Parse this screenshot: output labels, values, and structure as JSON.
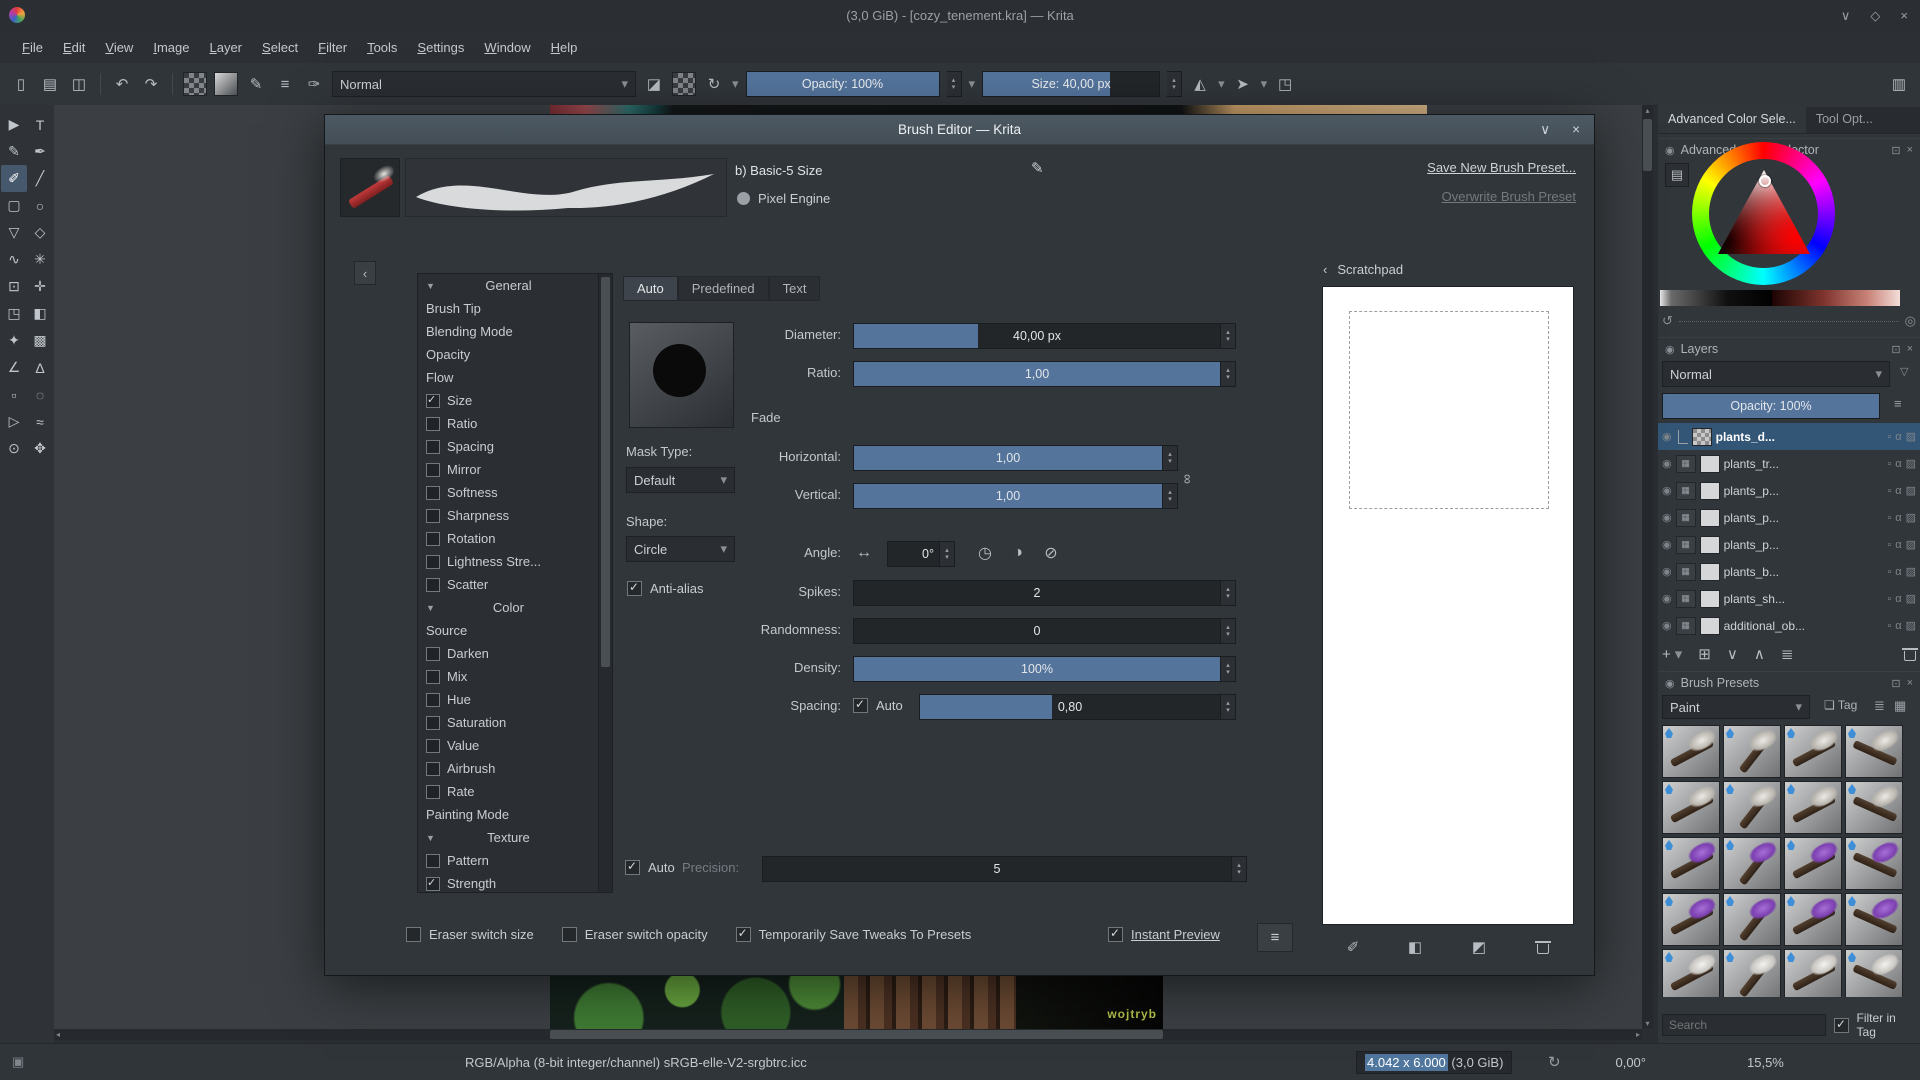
{
  "window": {
    "title": "(3,0 GiB) - [cozy_tenement.kra] — Krita"
  },
  "icons": {
    "shade": "∨",
    "maximize": "◇",
    "close": "×",
    "new_doc": "▯",
    "open": "▤",
    "save": "◫",
    "undo": "↶",
    "redo": "↷",
    "brush_settings": "✎",
    "choices": "≡",
    "brush": "✑",
    "eraser": "◪",
    "reload": "↻",
    "mirror_h": "◭",
    "mirror_v": "➤",
    "trim": "◳",
    "workspace": "▥",
    "collapse": "‹",
    "pencil": "✎",
    "flip": "↔",
    "dial": "◷",
    "half": "◑",
    "slash": "⊘",
    "chain": "∞",
    "burger": "≡",
    "float": "⊡",
    "list_btn": "▤",
    "refresh": "↺",
    "funnel": "▽",
    "eye": "◉",
    "alpha": "α",
    "layer_style": "▨",
    "lock": "▫",
    "plus": "+",
    "duplicate": "⊞",
    "down": "∨",
    "up": "∧",
    "props": "≣",
    "tag": "❏",
    "view_list": "≣",
    "view_grid": "▦",
    "sp_brush": "✐",
    "sp_shade": "◧",
    "sp_fill": "◩",
    "rotation": "↻",
    "selection": "▣",
    "docker_dot": "◉"
  },
  "menu": {
    "items": [
      "File",
      "Edit",
      "View",
      "Image",
      "Layer",
      "Select",
      "Filter",
      "Tools",
      "Settings",
      "Window",
      "Help"
    ]
  },
  "toolbar": {
    "blending_mode": "Normal",
    "opacity_label": "Opacity: 100%",
    "opacity_fill": 100,
    "size_label": "Size: 40,00 px",
    "size_fill": 72
  },
  "toolbox": {
    "tools": [
      {
        "name": "select-shapes-tool",
        "glyph": "▶"
      },
      {
        "name": "text-tool",
        "glyph": "T"
      },
      {
        "name": "edit-shapes-tool",
        "glyph": "✎"
      },
      {
        "name": "calligraphy-tool",
        "glyph": "✒"
      },
      {
        "name": "freehand-brush-tool",
        "glyph": "✐",
        "active": true
      },
      {
        "name": "line-tool",
        "glyph": "╱"
      },
      {
        "name": "rectangle-tool",
        "glyph": "▢"
      },
      {
        "name": "ellipse-tool",
        "glyph": "○"
      },
      {
        "name": "polygon-tool",
        "glyph": "▽"
      },
      {
        "name": "polyline-tool",
        "glyph": "◇"
      },
      {
        "name": "bezier-curve-tool",
        "glyph": "∿"
      },
      {
        "name": "multibrush-tool",
        "glyph": "✳"
      },
      {
        "name": "transform-tool",
        "glyph": "⊡"
      },
      {
        "name": "move-tool",
        "glyph": "✛"
      },
      {
        "name": "crop-tool",
        "glyph": "◳"
      },
      {
        "name": "gradient-tool",
        "glyph": "◧"
      },
      {
        "name": "color-sampler-tool",
        "glyph": "✦"
      },
      {
        "name": "smart-patch-tool",
        "glyph": "▩"
      },
      {
        "name": "assistants-tool",
        "glyph": "∠"
      },
      {
        "name": "measure-tool",
        "glyph": "Δ"
      },
      {
        "name": "rectangular-selection-tool",
        "glyph": "▫"
      },
      {
        "name": "elliptical-selection-tool",
        "glyph": "◌"
      },
      {
        "name": "polygonal-selection-tool",
        "glyph": "▷"
      },
      {
        "name": "freehand-selection-tool",
        "glyph": "≈"
      },
      {
        "name": "zoom-tool",
        "glyph": "⊙"
      },
      {
        "name": "pan-tool",
        "glyph": "✥"
      }
    ]
  },
  "canvas": {
    "watermark": "wojtryb"
  },
  "dialog": {
    "title": "Brush Editor — Krita",
    "preset_name": "b) Basic-5 Size",
    "engine": "Pixel Engine",
    "save_button": "Save New Brush Preset...",
    "overwrite_button": "Overwrite Brush Preset",
    "tabs": [
      {
        "label": "Auto",
        "active": true
      },
      {
        "label": "Predefined"
      },
      {
        "label": "Text"
      }
    ],
    "options": [
      {
        "label": "General",
        "type": "header"
      },
      {
        "label": "Brush Tip",
        "type": "plain"
      },
      {
        "label": "Blending Mode",
        "type": "plain"
      },
      {
        "label": "Opacity",
        "type": "plain"
      },
      {
        "label": "Flow",
        "type": "plain"
      },
      {
        "label": "Size",
        "type": "check",
        "checked": true
      },
      {
        "label": "Ratio",
        "type": "check"
      },
      {
        "label": "Spacing",
        "type": "check"
      },
      {
        "label": "Mirror",
        "type": "check"
      },
      {
        "label": "Softness",
        "type": "check"
      },
      {
        "label": "Sharpness",
        "type": "check"
      },
      {
        "label": "Rotation",
        "type": "check"
      },
      {
        "label": "Lightness Stre...",
        "type": "check"
      },
      {
        "label": "Scatter",
        "type": "check"
      },
      {
        "label": "Color",
        "type": "header"
      },
      {
        "label": "Source",
        "type": "plain"
      },
      {
        "label": "Darken",
        "type": "check"
      },
      {
        "label": "Mix",
        "type": "check"
      },
      {
        "label": "Hue",
        "type": "check"
      },
      {
        "label": "Saturation",
        "type": "check"
      },
      {
        "label": "Value",
        "type": "check"
      },
      {
        "label": "Airbrush",
        "type": "check"
      },
      {
        "label": "Rate",
        "type": "check"
      },
      {
        "label": "Painting Mode",
        "type": "plain"
      },
      {
        "label": "Texture",
        "type": "header"
      },
      {
        "label": "Pattern",
        "type": "check"
      },
      {
        "label": "Strength",
        "type": "check",
        "checked": true
      }
    ],
    "fields": {
      "diameter_label": "Diameter:",
      "diameter_value": "40,00 px",
      "diameter_fill": 34,
      "ratio_label": "Ratio:",
      "ratio_value": "1,00",
      "ratio_fill": 100,
      "fade_label": "Fade",
      "mask_type_label": "Mask Type:",
      "mask_type_value": "Default",
      "horizontal_label": "Horizontal:",
      "horizontal_value": "1,00",
      "horizontal_fill": 100,
      "vertical_label": "Vertical:",
      "vertical_value": "1,00",
      "vertical_fill": 100,
      "shape_label": "Shape:",
      "shape_value": "Circle",
      "angle_label": "Angle:",
      "angle_value": "0°",
      "antialias_label": "Anti-alias",
      "spikes_label": "Spikes:",
      "spikes_value": "2",
      "spikes_fill": 0,
      "randomness_label": "Randomness:",
      "randomness_value": "0",
      "randomness_fill": 0,
      "density_label": "Density:",
      "density_value": "100%",
      "density_fill": 100,
      "spacing_label": "Spacing:",
      "spacing_value": "0,80",
      "spacing_fill": 44,
      "auto_label": "Auto",
      "precision_label": "Precision:",
      "precision_value": "5",
      "precision_fill": 0
    },
    "footer": {
      "eraser_size": "Eraser switch size",
      "eraser_opacity": "Eraser switch opacity",
      "tweaks": "Temporarily Save Tweaks To Presets",
      "instant_preview": "Instant Preview"
    },
    "scratchpad": {
      "title": "Scratchpad"
    }
  },
  "docker": {
    "tabs": [
      {
        "label": "Advanced Color Sele...",
        "active": true
      },
      {
        "label": "Tool Opt..."
      }
    ],
    "color_selector": {
      "title": "Advanced Color Selector"
    },
    "layers": {
      "title": "Layers",
      "blending_mode": "Normal",
      "opacity_label": "Opacity: 100%",
      "opacity_fill": 100,
      "rows": [
        {
          "name": "plants_d...",
          "selected": true
        },
        {
          "name": "plants_tr..."
        },
        {
          "name": "plants_p..."
        },
        {
          "name": "plants_p..."
        },
        {
          "name": "plants_p..."
        },
        {
          "name": "plants_b..."
        },
        {
          "name": "plants_sh..."
        },
        {
          "name": "additional_ob..."
        }
      ]
    },
    "brush_presets": {
      "title": "Brush Presets",
      "tag_filter": "Paint",
      "tag_button": "Tag",
      "search_placeholder": "Search",
      "filter_in_tag": "Filter in Tag",
      "count": 20
    }
  },
  "statusbar": {
    "colorspace": "RGB/Alpha (8-bit integer/channel)  sRGB-elle-V2-srgbtrc.icc",
    "dimensions": "4.042 x 6.000",
    "memory": " (3,0 GiB)",
    "rotation": "0,00°",
    "zoom": "15,5%"
  }
}
